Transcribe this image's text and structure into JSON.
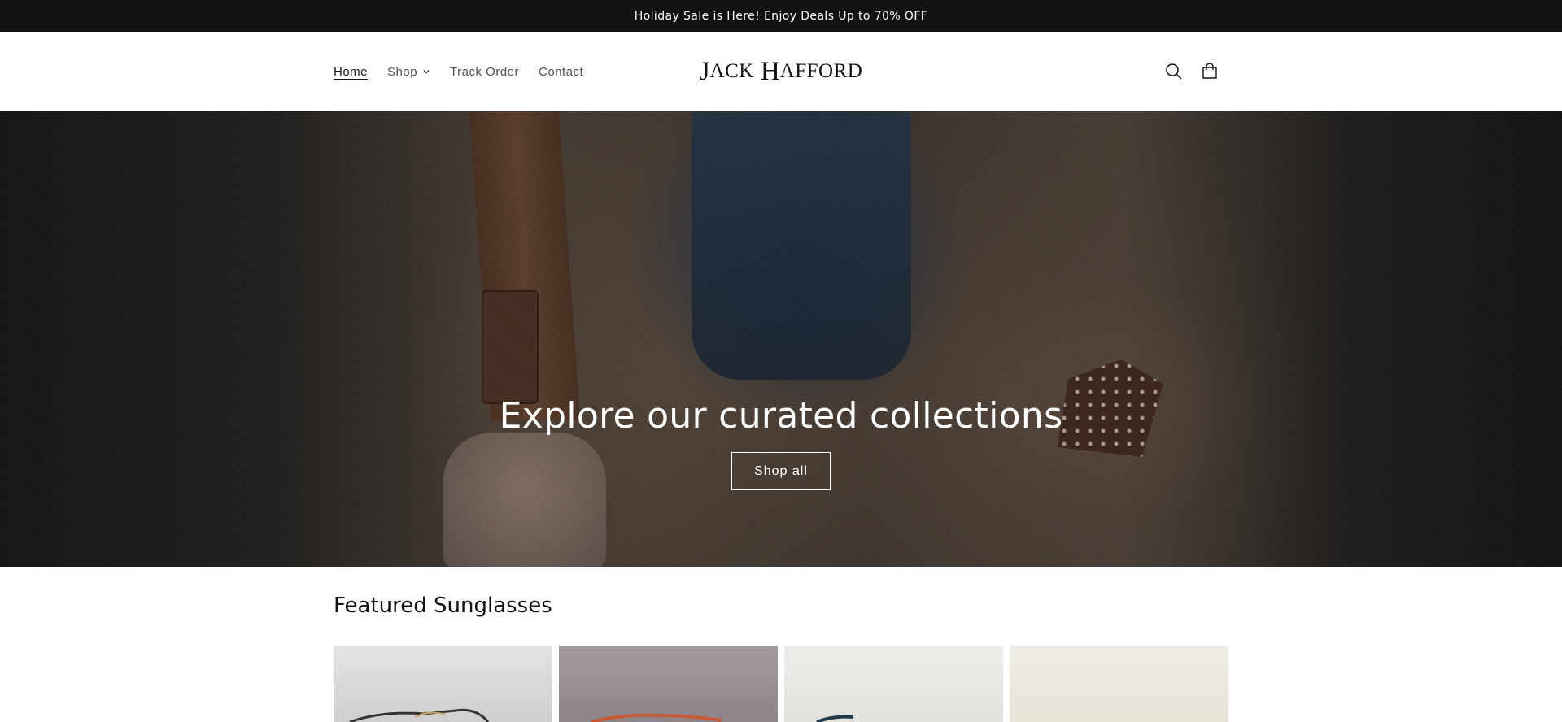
{
  "announcement": {
    "text": "Holiday Sale is Here! Enjoy Deals Up to 70% OFF"
  },
  "header": {
    "nav": [
      {
        "label": "Home",
        "active": true
      },
      {
        "label": "Shop",
        "has_dropdown": true
      },
      {
        "label": "Track Order"
      },
      {
        "label": "Contact"
      }
    ],
    "logo": {
      "text": "Jack Hafford"
    },
    "icons": [
      "search-icon",
      "cart-icon"
    ]
  },
  "hero": {
    "title": "Explore our curated collections",
    "button_label": "Shop all"
  },
  "featured": {
    "title": "Featured Sunglasses",
    "products": [
      {
        "image_color": "#d9d9d9"
      },
      {
        "image_color": "#9a9196"
      },
      {
        "image_color": "#e8e8e4"
      },
      {
        "image_color": "#ebe9e0"
      }
    ]
  }
}
